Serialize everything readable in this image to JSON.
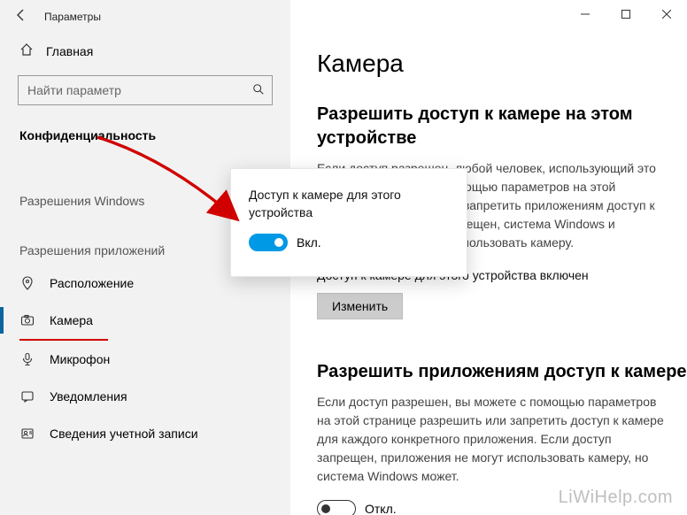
{
  "window": {
    "title": "Параметры",
    "home_label": "Главная",
    "search_placeholder": "Найти параметр"
  },
  "sidebar": {
    "privacy_title": "Конфиденциальность",
    "group_windows": "Разрешения Windows",
    "group_apps": "Разрешения приложений",
    "items": {
      "location": "Расположение",
      "camera": "Камера",
      "microphone": "Микрофон",
      "notifications": "Уведомления",
      "account_info": "Сведения учетной записи"
    }
  },
  "content": {
    "page_title": "Камера",
    "section1_title": "Разрешить доступ к камере на этом устройстве",
    "section1_body": "Если доступ разрешен, любой человек, использующий это устройство, сможет с помощью параметров на этой странице разрешить или запретить приложениям доступ к камере. Если доступ запрещен, система Windows и приложения не смогут использовать камеру.",
    "device_status": "Доступ к камере для этого устройства включен",
    "change_button": "Изменить",
    "section2_title": "Разрешить приложениям доступ к камере",
    "section2_body": "Если доступ разрешен, вы можете с помощью параметров на этой странице разрешить или запретить доступ к камере для каждого конкретного приложения. Если доступ запрещен, приложения не могут использовать камеру, но система Windows может.",
    "apps_toggle_label": "Откл."
  },
  "popup": {
    "title": "Доступ к камере для этого устройства",
    "toggle_label": "Вкл.",
    "toggle_on": true
  },
  "watermark": "LiWiHelp.com"
}
